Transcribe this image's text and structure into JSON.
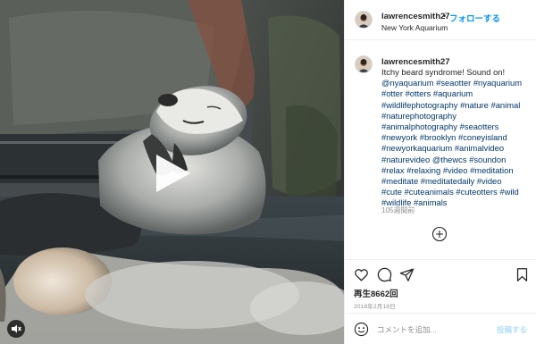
{
  "post": {
    "username": "lawrencesmith27",
    "follow_label": "フォローする",
    "dot": "•",
    "location": "New York Aquarium"
  },
  "caption": {
    "username": "lawrencesmith27",
    "lines": [
      [
        {
          "t": "Itchy beard syndrome! Sound on!",
          "tag": false
        }
      ],
      [
        {
          "t": "@nyaquarium",
          "tag": true
        },
        {
          "t": " ",
          "tag": false
        },
        {
          "t": "#seaotter",
          "tag": true
        },
        {
          "t": " ",
          "tag": false
        },
        {
          "t": "#nyaquarium",
          "tag": true
        }
      ],
      [
        {
          "t": "#otter",
          "tag": true
        },
        {
          "t": " ",
          "tag": false
        },
        {
          "t": "#otters",
          "tag": true
        },
        {
          "t": " ",
          "tag": false
        },
        {
          "t": "#aquarium",
          "tag": true
        }
      ],
      [
        {
          "t": "#wildlifephotography",
          "tag": true
        },
        {
          "t": " ",
          "tag": false
        },
        {
          "t": "#nature",
          "tag": true
        },
        {
          "t": " ",
          "tag": false
        },
        {
          "t": "#animal",
          "tag": true
        }
      ],
      [
        {
          "t": "#naturephotography",
          "tag": true
        }
      ],
      [
        {
          "t": "#animalphotography",
          "tag": true
        },
        {
          "t": " ",
          "tag": false
        },
        {
          "t": "#seaotters",
          "tag": true
        }
      ],
      [
        {
          "t": "#newyork",
          "tag": true
        },
        {
          "t": " ",
          "tag": false
        },
        {
          "t": "#brooklyn",
          "tag": true
        },
        {
          "t": " ",
          "tag": false
        },
        {
          "t": "#coneyisland",
          "tag": true
        }
      ],
      [
        {
          "t": "#newyorkaquarium",
          "tag": true
        },
        {
          "t": " ",
          "tag": false
        },
        {
          "t": "#animalvideo",
          "tag": true
        }
      ],
      [
        {
          "t": "#naturevideo",
          "tag": true
        },
        {
          "t": " ",
          "tag": false
        },
        {
          "t": "@thewcs",
          "tag": true
        },
        {
          "t": " ",
          "tag": false
        },
        {
          "t": "#soundon",
          "tag": true
        }
      ],
      [
        {
          "t": "#relax",
          "tag": true
        },
        {
          "t": " ",
          "tag": false
        },
        {
          "t": "#relaxing",
          "tag": true
        },
        {
          "t": " ",
          "tag": false
        },
        {
          "t": "#video",
          "tag": true
        },
        {
          "t": " ",
          "tag": false
        },
        {
          "t": "#meditation",
          "tag": true
        }
      ],
      [
        {
          "t": "#meditate",
          "tag": true
        },
        {
          "t": " ",
          "tag": false
        },
        {
          "t": "#meditatedaily",
          "tag": true
        },
        {
          "t": " ",
          "tag": false
        },
        {
          "t": "#video",
          "tag": true
        }
      ],
      [
        {
          "t": "#cute",
          "tag": true
        },
        {
          "t": " ",
          "tag": false
        },
        {
          "t": "#cuteanimals",
          "tag": true
        },
        {
          "t": " ",
          "tag": false
        },
        {
          "t": "#cuteotters",
          "tag": true
        },
        {
          "t": " ",
          "tag": false
        },
        {
          "t": "#wild",
          "tag": true
        }
      ],
      [
        {
          "t": "#wildlife",
          "tag": true
        },
        {
          "t": " ",
          "tag": false
        },
        {
          "t": "#animals",
          "tag": true
        }
      ]
    ],
    "time_ago": "105週間前"
  },
  "icons": {
    "play": "play-icon",
    "mute": "speaker-muted-icon",
    "more": "plus-circle-icon",
    "like": "heart-icon",
    "comment": "comment-icon",
    "share": "paper-plane-icon",
    "save": "bookmark-icon",
    "emoji": "smiley-icon"
  },
  "stats": {
    "views": "再生8662回",
    "date": "2018年2月18日"
  },
  "comment": {
    "placeholder": "コメントを追加...",
    "value": "",
    "post_label": "投稿する"
  },
  "colors": {
    "link": "#00376b",
    "follow": "#0095f6",
    "post_disabled": "#b2dffc",
    "muted": "#8e8e8e"
  }
}
